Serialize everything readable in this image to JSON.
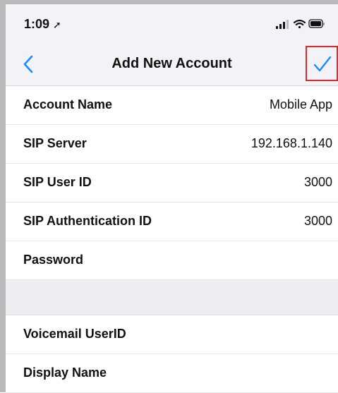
{
  "status_bar": {
    "time": "1:09",
    "location_icon": "location-arrow-icon",
    "signal_icon": "cellular-signal-icon",
    "wifi_icon": "wifi-icon",
    "battery_icon": "battery-icon"
  },
  "nav": {
    "back_icon": "chevron-left-icon",
    "title": "Add New Account",
    "done_icon": "checkmark-icon"
  },
  "fields": [
    {
      "label": "Account Name",
      "value": "Mobile App"
    },
    {
      "label": "SIP Server",
      "value": "192.168.1.140"
    },
    {
      "label": "SIP User ID",
      "value": "3000"
    },
    {
      "label": "SIP Authentication ID",
      "value": "3000"
    },
    {
      "label": "Password",
      "value": ""
    }
  ],
  "fields2": [
    {
      "label": "Voicemail UserID",
      "value": ""
    },
    {
      "label": "Display Name",
      "value": ""
    }
  ],
  "colors": {
    "accent": "#1a8cff",
    "highlight_border": "#e1262c",
    "nav_background": "#f2f2f7"
  }
}
